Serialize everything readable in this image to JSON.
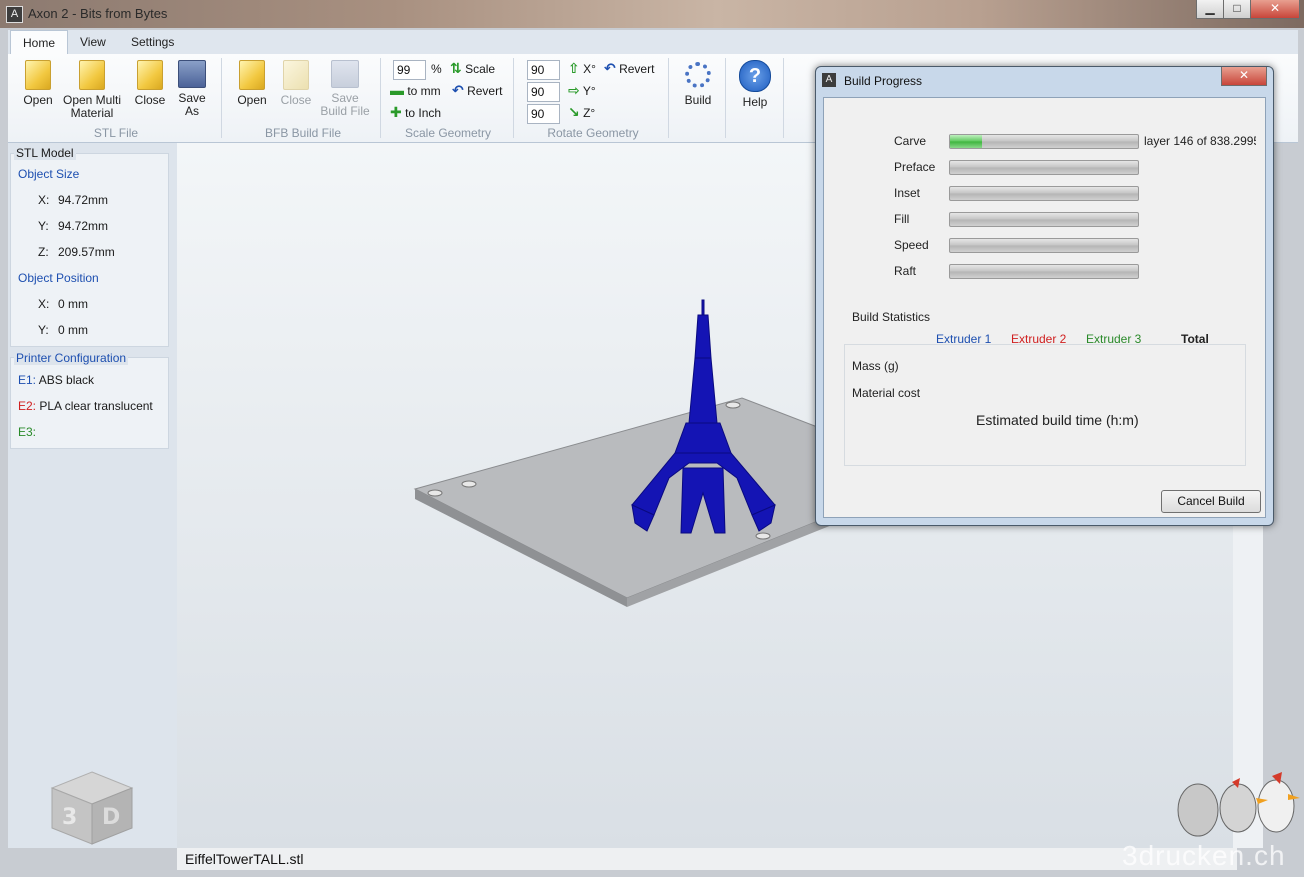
{
  "window": {
    "title": "Axon 2 - Bits from Bytes",
    "minimize": "▁",
    "maximize": "□",
    "close": "✕"
  },
  "tabs": [
    "Home",
    "View",
    "Settings"
  ],
  "ribbon": {
    "stl": {
      "open": "Open",
      "open_multi_1": "Open Multi",
      "open_multi_2": "Material",
      "close": "Close",
      "save_as_1": "Save",
      "save_as_2": "As",
      "group": "STL File"
    },
    "bfb": {
      "open": "Open",
      "close": "Close",
      "save_1": "Save",
      "save_2": "Build File",
      "group": "BFB Build File"
    },
    "scale": {
      "value": "99",
      "percent": "%",
      "scale": "Scale",
      "to_mm": "to mm",
      "revert": "Revert",
      "to_inch": "to Inch",
      "group": "Scale Geometry"
    },
    "rotate": {
      "x_value": "90",
      "y_value": "90",
      "z_value": "90",
      "x": "X°",
      "y": "Y°",
      "z": "Z°",
      "revert": "Revert",
      "group": "Rotate Geometry"
    },
    "build": "Build",
    "help": "Help"
  },
  "stl_model": {
    "title": "STL Model",
    "object_size": "Object Size",
    "size": [
      {
        "axis": "X:",
        "value": "94.72mm"
      },
      {
        "axis": "Y:",
        "value": "94.72mm"
      },
      {
        "axis": "Z:",
        "value": "209.57mm"
      }
    ],
    "object_position": "Object Position",
    "position": [
      {
        "axis": "X:",
        "value": "0 mm"
      },
      {
        "axis": "Y:",
        "value": "0 mm"
      }
    ]
  },
  "printer": {
    "title": "Printer Configuration",
    "extruders": [
      {
        "id": "E1:",
        "material": "ABS black",
        "color": "#1d4fb0"
      },
      {
        "id": "E2:",
        "material": "PLA clear translucent",
        "color": "#d02020"
      },
      {
        "id": "E3:",
        "material": "",
        "color": "#2a8a2a"
      }
    ]
  },
  "filename": "EiffelTowerTALL.stl",
  "watermark": "3drucken.ch",
  "dialog": {
    "title": "Build Progress",
    "close": "✕",
    "stages": [
      {
        "label": "Carve",
        "progress": 0.17,
        "status": "layer 146 of 838.2995"
      },
      {
        "label": "Preface",
        "progress": 0,
        "status": ""
      },
      {
        "label": "Inset",
        "progress": 0,
        "status": ""
      },
      {
        "label": "Fill",
        "progress": 0,
        "status": ""
      },
      {
        "label": "Speed",
        "progress": 0,
        "status": ""
      },
      {
        "label": "Raft",
        "progress": 0,
        "status": ""
      }
    ],
    "stats": {
      "title": "Build Statistics",
      "extruder1": "Extruder 1",
      "extruder2": "Extruder 2",
      "extruder3": "Extruder 3",
      "total": "Total",
      "mass": "Mass (g)",
      "cost": "Material cost",
      "time": "Estimated build time (h:m)"
    },
    "cancel": "Cancel Build"
  }
}
